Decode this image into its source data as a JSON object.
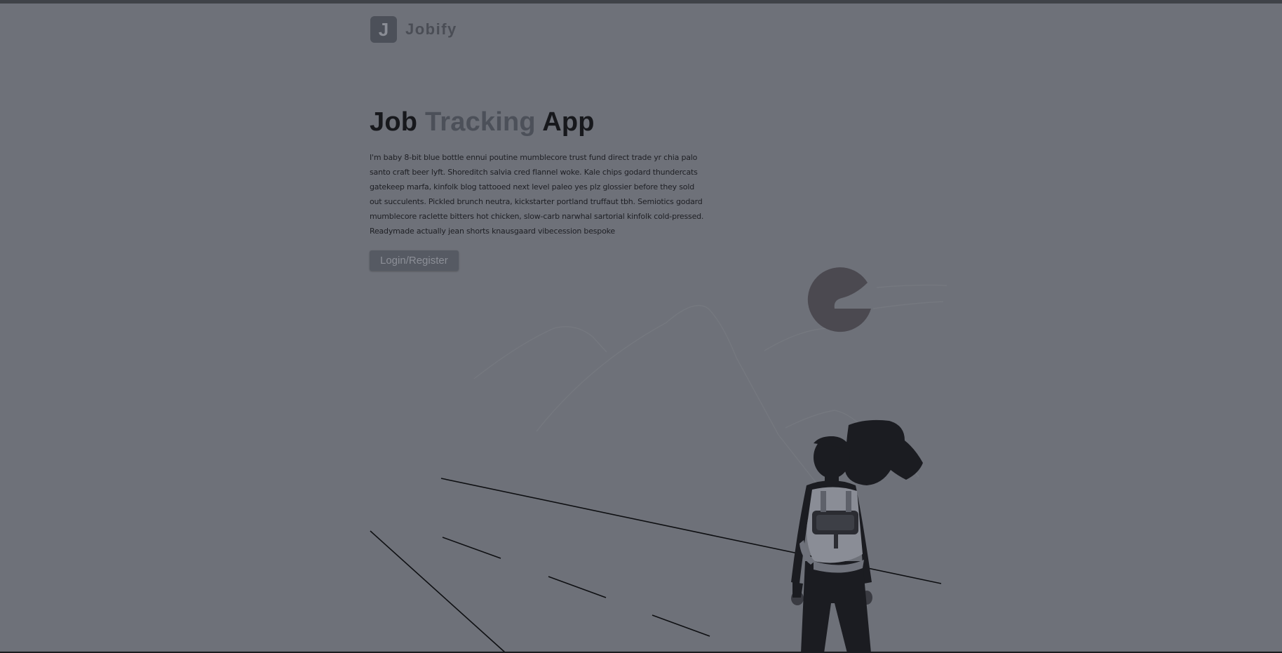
{
  "brand": {
    "logo_letter": "J",
    "name": "Jobify"
  },
  "hero": {
    "title_start": "Job",
    "title_accent": "Tracking",
    "title_end": "App",
    "intro": "I'm baby 8-bit blue bottle ennui poutine mumblecore trust fund direct trade yr chia palo santo craft beer lyft. Shoreditch salvia cred flannel woke. Kale chips godard thundercats gatekeep marfa, kinfolk blog tattooed next level paleo yes plz glossier before they sold out succulents. Pickled brunch neutra, kickstarter portland truffaut tbh. Semiotics godard mumblecore raclette bitters hot chicken, slow-carb narwhal sartorial kinfolk cold-pressed. Readymade actually jean shorts knausgaard vibecession bespoke",
    "cta_label": "Login/Register"
  },
  "colors": {
    "overlay_background": "#6e7179",
    "accent": "#4c5059",
    "text": "#17181c"
  }
}
